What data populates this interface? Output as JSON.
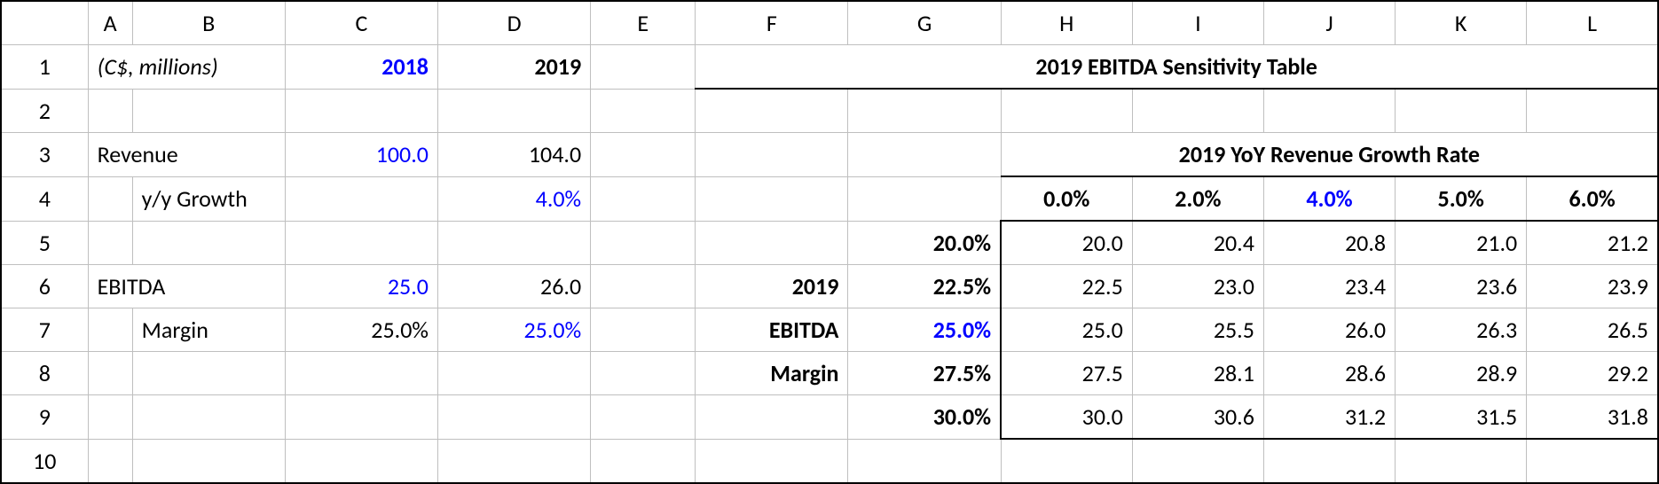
{
  "colHeaders": [
    "A",
    "B",
    "C",
    "D",
    "E",
    "F",
    "G",
    "H",
    "I",
    "J",
    "K",
    "L"
  ],
  "rowHeaders": [
    "1",
    "2",
    "3",
    "4",
    "5",
    "6",
    "7",
    "8",
    "9",
    "10"
  ],
  "left": {
    "unitsNote": "(C$, millions)",
    "year1": "2018",
    "year2": "2019",
    "revenueLabel": "Revenue",
    "revenue": {
      "y1": "100.0",
      "y2": "104.0"
    },
    "yoyGrowthLabel": "y/y Growth",
    "yoyGrowth": {
      "y2": "4.0%"
    },
    "ebitdaLabel": "EBITDA",
    "ebitda": {
      "y1": "25.0",
      "y2": "26.0"
    },
    "marginLabel": "Margin",
    "margin": {
      "y1": "25.0%",
      "y2": "25.0%"
    }
  },
  "sens": {
    "title": "2019 EBITDA Sensitivity Table",
    "subTitle": "2019 YoY Revenue Growth Rate",
    "sideLabel1": "2019",
    "sideLabel2": "EBITDA",
    "sideLabel3": "Margin",
    "growthHeaders": [
      "0.0%",
      "2.0%",
      "4.0%",
      "5.0%",
      "6.0%"
    ],
    "marginHeaders": [
      "20.0%",
      "22.5%",
      "25.0%",
      "27.5%",
      "30.0%"
    ],
    "body": [
      [
        "20.0",
        "20.4",
        "20.8",
        "21.0",
        "21.2"
      ],
      [
        "22.5",
        "23.0",
        "23.4",
        "23.6",
        "23.9"
      ],
      [
        "25.0",
        "25.5",
        "26.0",
        "26.3",
        "26.5"
      ],
      [
        "27.5",
        "28.1",
        "28.6",
        "28.9",
        "29.2"
      ],
      [
        "30.0",
        "30.6",
        "31.2",
        "31.5",
        "31.8"
      ]
    ]
  },
  "chart_data": {
    "type": "table",
    "title": "2019 EBITDA Sensitivity Table",
    "xlabel": "2019 YoY Revenue Growth Rate",
    "ylabel": "2019 EBITDA Margin",
    "x": [
      0.0,
      2.0,
      4.0,
      5.0,
      6.0
    ],
    "y": [
      20.0,
      22.5,
      25.0,
      27.5,
      30.0
    ],
    "values": [
      [
        20.0,
        20.4,
        20.8,
        21.0,
        21.2
      ],
      [
        22.5,
        23.0,
        23.4,
        23.6,
        23.9
      ],
      [
        25.0,
        25.5,
        26.0,
        26.3,
        26.5
      ],
      [
        27.5,
        28.1,
        28.6,
        28.9,
        29.2
      ],
      [
        30.0,
        30.6,
        31.2,
        31.5,
        31.8
      ]
    ]
  }
}
